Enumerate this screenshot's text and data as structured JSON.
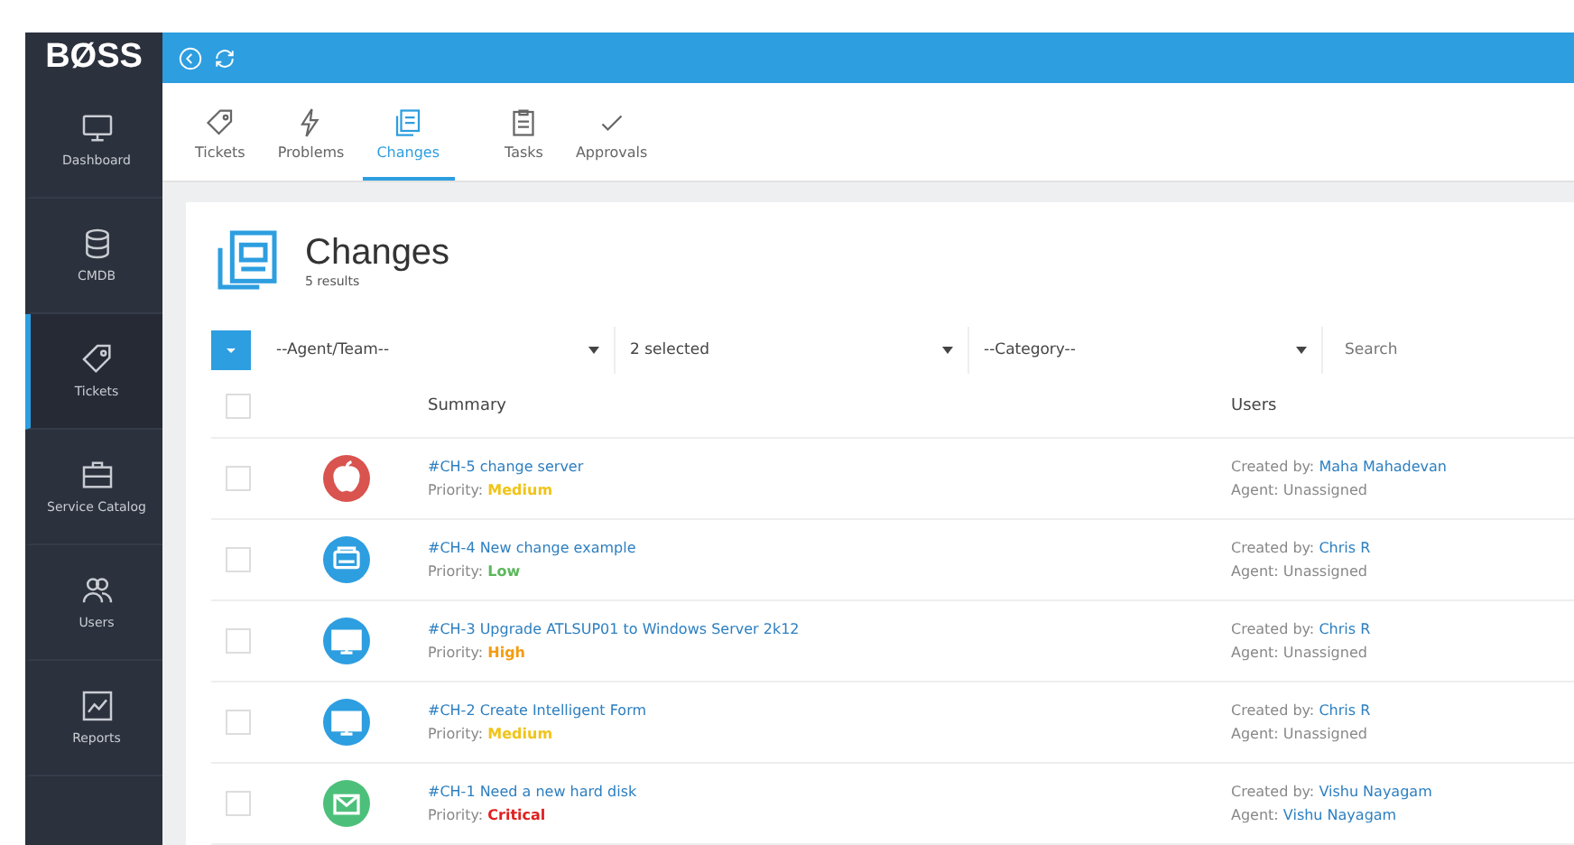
{
  "logo": "BØSS",
  "sidebar": {
    "items": [
      {
        "label": "Dashboard",
        "kind": "monitor",
        "selected": false
      },
      {
        "label": "CMDB",
        "kind": "database",
        "selected": false
      },
      {
        "label": "Tickets",
        "kind": "tag",
        "selected": true
      },
      {
        "label": "Service Catalog",
        "kind": "briefcase",
        "selected": false
      },
      {
        "label": "Users",
        "kind": "users",
        "selected": false
      },
      {
        "label": "Reports",
        "kind": "chart",
        "selected": false
      }
    ]
  },
  "tabs": [
    {
      "label": "Tickets",
      "kind": "tag",
      "selected": false
    },
    {
      "label": "Problems",
      "kind": "bolt",
      "selected": false
    },
    {
      "label": "Changes",
      "kind": "doc",
      "selected": true
    },
    {
      "label": "Tasks",
      "kind": "clipboard",
      "selected": false
    },
    {
      "label": "Approvals",
      "kind": "check",
      "selected": false
    }
  ],
  "page": {
    "title": "Changes",
    "subtitle": "5 results"
  },
  "filters": {
    "agent": "--Agent/Team--",
    "status": "2 selected",
    "category": "--Category--",
    "search_placeholder": "Search"
  },
  "table": {
    "select_all_checked": false,
    "columns": [
      "Summary",
      "Users"
    ],
    "rows": [
      {
        "title": "#CH-5 change server",
        "priority_label": "Priority:",
        "priority": {
          "text": "Medium",
          "color": "#f0c419"
        },
        "icon": {
          "kind": "apple",
          "color": "#d9534f"
        },
        "created_label": "Created by:",
        "created_by": "Maha Mahadevan",
        "agent_label": "Agent:",
        "agent": "Unassigned",
        "agent_link": false,
        "checked": false
      },
      {
        "title": "#CH-4 New change example",
        "priority_label": "Priority:",
        "priority": {
          "text": "Low",
          "color": "#5cb85c"
        },
        "icon": {
          "kind": "printer",
          "color": "#2d9ee0"
        },
        "created_label": "Created by:",
        "created_by": "Chris R",
        "agent_label": "Agent:",
        "agent": "Unassigned",
        "agent_link": false,
        "checked": false
      },
      {
        "title": "#CH-3 Upgrade ATLSUP01 to Windows Server 2k12",
        "priority_label": "Priority:",
        "priority": {
          "text": "High",
          "color": "#f39c12"
        },
        "icon": {
          "kind": "monitor",
          "color": "#2d9ee0"
        },
        "created_label": "Created by:",
        "created_by": "Chris R",
        "agent_label": "Agent:",
        "agent": "Unassigned",
        "agent_link": false,
        "checked": false
      },
      {
        "title": "#CH-2 Create Intelligent Form",
        "priority_label": "Priority:",
        "priority": {
          "text": "Medium",
          "color": "#f0c419"
        },
        "icon": {
          "kind": "monitor",
          "color": "#2d9ee0"
        },
        "created_label": "Created by:",
        "created_by": "Chris R",
        "agent_label": "Agent:",
        "agent": "Unassigned",
        "agent_link": false,
        "checked": false
      },
      {
        "title": "#CH-1 Need a new hard disk",
        "priority_label": "Priority:",
        "priority": {
          "text": "Critical",
          "color": "#e02020"
        },
        "icon": {
          "kind": "mail",
          "color": "#4cc07a"
        },
        "created_label": "Created by:",
        "created_by": "Vishu Nayagam",
        "agent_label": "Agent:",
        "agent": "Vishu Nayagam",
        "agent_link": true,
        "checked": false
      }
    ]
  }
}
